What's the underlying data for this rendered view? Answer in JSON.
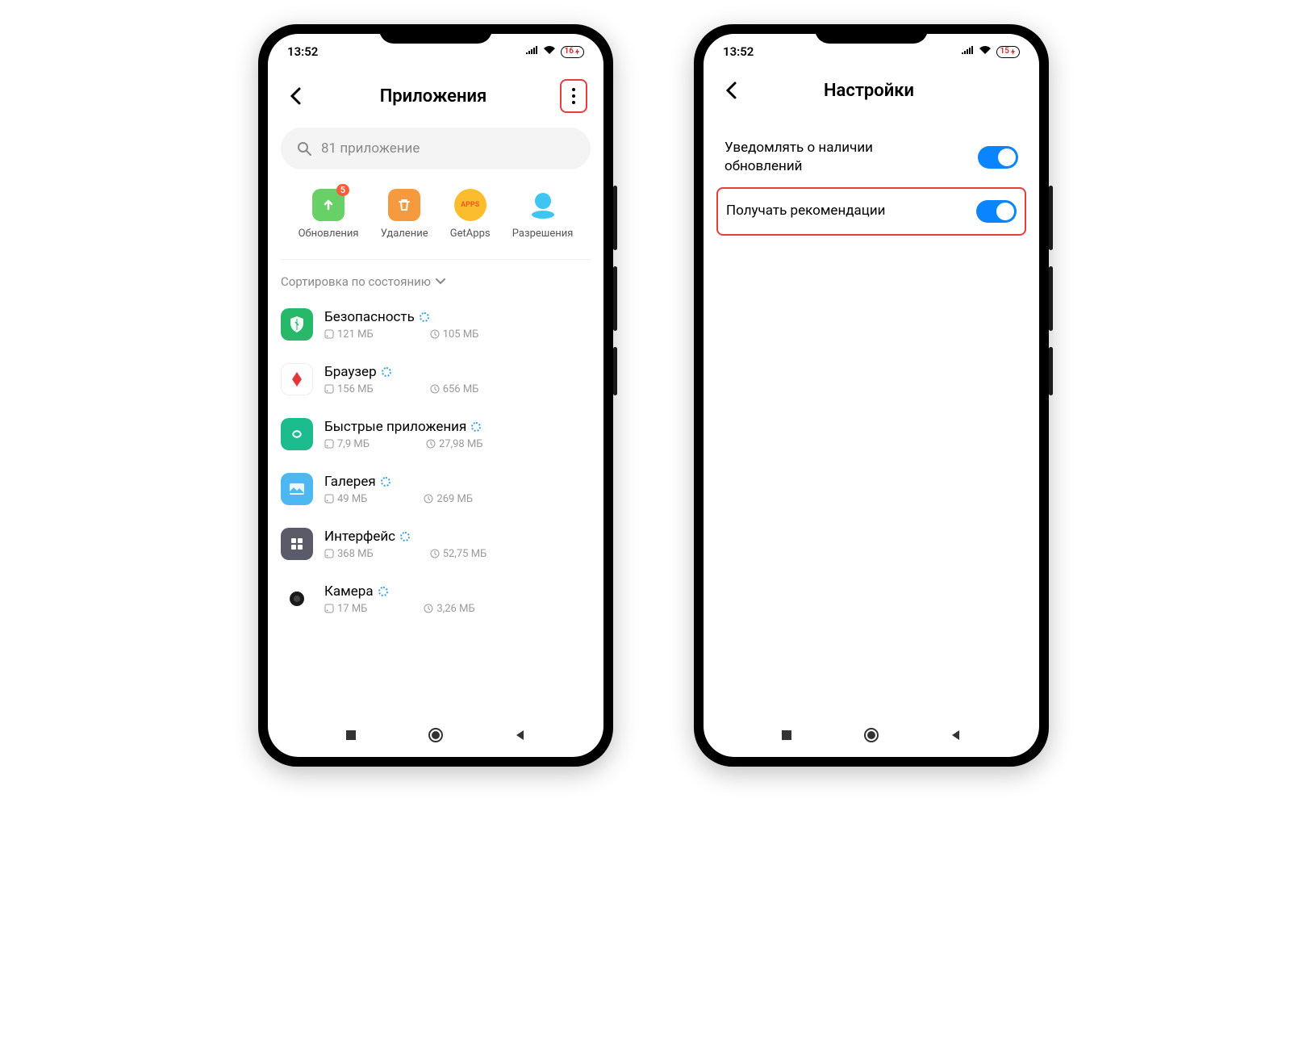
{
  "statusBar": {
    "time": "13:52",
    "battery1": "16",
    "battery2": "15"
  },
  "screen1": {
    "title": "Приложения",
    "searchPlaceholder": "81 приложение",
    "actions": {
      "updates": "Обновления",
      "updatesBadge": "5",
      "uninstall": "Удаление",
      "getapps": "GetApps",
      "permissions": "Разрешения"
    },
    "sortLabel": "Сортировка по состоянию",
    "apps": [
      {
        "name": "Безопасность",
        "storage": "121 МБ",
        "data": "105 МБ"
      },
      {
        "name": "Браузер",
        "storage": "156 МБ",
        "data": "656 МБ"
      },
      {
        "name": "Быстрые приложения",
        "storage": "7,9 МБ",
        "data": "27,98 МБ"
      },
      {
        "name": "Галерея",
        "storage": "49 МБ",
        "data": "269 МБ"
      },
      {
        "name": "Интерфейс",
        "storage": "368 МБ",
        "data": "52,75 МБ"
      },
      {
        "name": "Камера",
        "storage": "17 МБ",
        "data": "3,26 МБ"
      }
    ]
  },
  "screen2": {
    "title": "Настройки",
    "settings": {
      "updateNotify": "Уведомлять о наличии обновлений",
      "recommendations": "Получать рекомендации"
    }
  }
}
